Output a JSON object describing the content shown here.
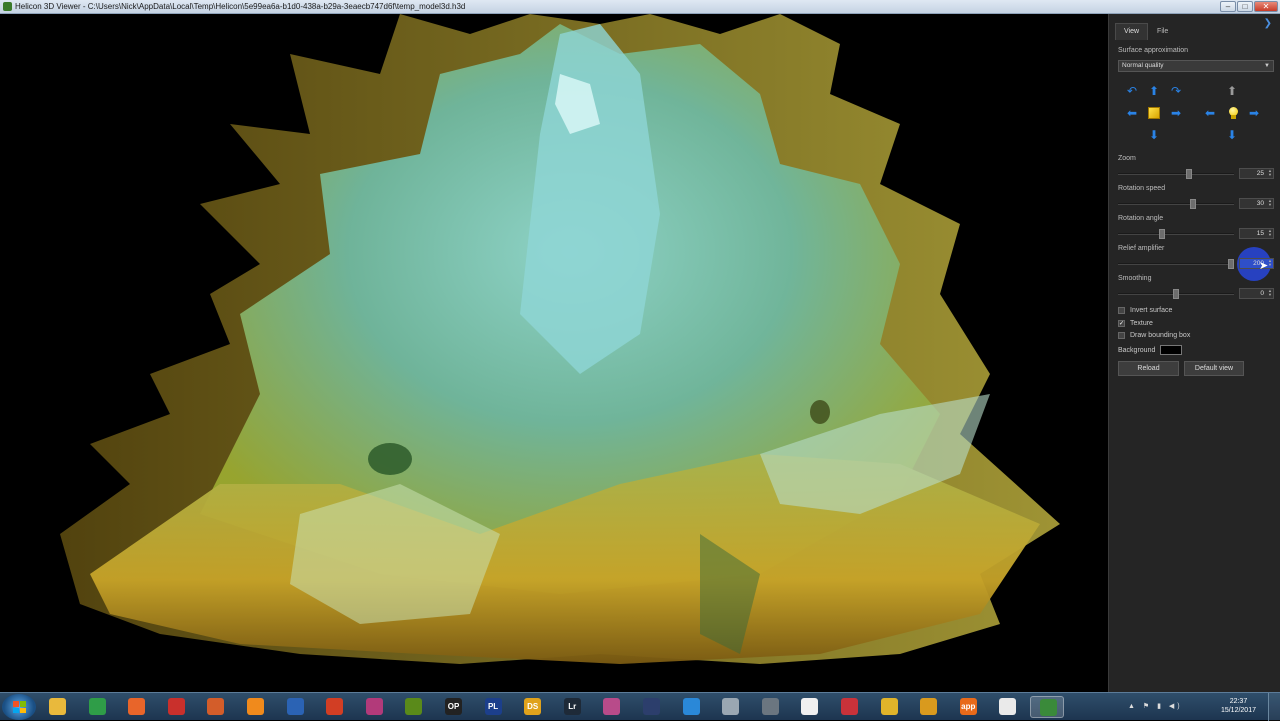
{
  "window": {
    "title": "Helicon 3D Viewer - C:\\Users\\Nick\\AppData\\Local\\Temp\\Helicon\\5e99ea6a-b1d0-438a-b29a-3eaecb747d6f\\temp_model3d.h3d",
    "min_label": "–",
    "max_label": "□",
    "close_label": "✕"
  },
  "panel": {
    "tabs": [
      {
        "label": "View",
        "active": true
      },
      {
        "label": "File",
        "active": false
      }
    ],
    "surface_approximation_label": "Surface approximation",
    "surface_approximation_value": "Normal quality",
    "zoom": {
      "label": "Zoom",
      "value": "25",
      "fraction": 0.62
    },
    "rotation_speed": {
      "label": "Rotation speed",
      "value": "30",
      "fraction": 0.65
    },
    "rotation_angle": {
      "label": "Rotation angle",
      "value": "15",
      "fraction": 0.37
    },
    "relief_amplifier": {
      "label": "Relief amplifier",
      "value": "200",
      "fraction": 1.0
    },
    "smoothing": {
      "label": "Smoothing",
      "value": "0",
      "fraction": 0.5
    },
    "invert_surface": {
      "label": "Invert surface",
      "checked": false
    },
    "texture": {
      "label": "Texture",
      "checked": true
    },
    "draw_bounding_box": {
      "label": "Draw bounding box",
      "checked": false
    },
    "background": {
      "label": "Background",
      "color": "#000000"
    },
    "reload_label": "Reload",
    "default_view_label": "Default view"
  },
  "taskbar": {
    "items": [
      {
        "icon": "explorer-icon",
        "text": "",
        "color": "#e9b93c"
      },
      {
        "icon": "chrome-icon",
        "text": "",
        "color": "#2f9d48"
      },
      {
        "icon": "firefox-icon",
        "text": "",
        "color": "#e8652a"
      },
      {
        "icon": "app-icon",
        "text": "",
        "color": "#c9302c"
      },
      {
        "icon": "eye-icon",
        "text": "",
        "color": "#d35d2a"
      },
      {
        "icon": "app-icon",
        "text": "",
        "color": "#f08a1c"
      },
      {
        "icon": "thunderbird-icon",
        "text": "",
        "color": "#2b63b4"
      },
      {
        "icon": "app-icon",
        "text": "",
        "color": "#d23e24"
      },
      {
        "icon": "app-icon",
        "text": "",
        "color": "#b23a7a"
      },
      {
        "icon": "app-icon",
        "text": "",
        "color": "#5a8a1a"
      },
      {
        "icon": "app-icon",
        "text": "OP",
        "color": "#222222"
      },
      {
        "icon": "app-icon",
        "text": "PL",
        "color": "#1c3f8c"
      },
      {
        "icon": "app-icon",
        "text": "DS",
        "color": "#e0a21c"
      },
      {
        "icon": "lightroom-icon",
        "text": "Lr",
        "color": "#1e2a38"
      },
      {
        "icon": "app-icon",
        "text": "",
        "color": "#b84b8a"
      },
      {
        "icon": "app-icon",
        "text": "",
        "color": "#2c3e6c"
      },
      {
        "icon": "app-icon",
        "text": "",
        "color": "#2a88d8"
      },
      {
        "icon": "app-icon",
        "text": "",
        "color": "#9aa7b2"
      },
      {
        "icon": "camera-icon",
        "text": "",
        "color": "#6b7680"
      },
      {
        "icon": "app-icon",
        "text": "",
        "color": "#f0f0f0"
      },
      {
        "icon": "app-icon",
        "text": "",
        "color": "#c8323a"
      },
      {
        "icon": "app-icon",
        "text": "",
        "color": "#e0b42a"
      },
      {
        "icon": "app-icon",
        "text": "",
        "color": "#d99a1e"
      },
      {
        "icon": "app-icon",
        "text": "app",
        "color": "#e86a1a"
      },
      {
        "icon": "document-icon",
        "text": "",
        "color": "#eaeaea"
      },
      {
        "icon": "helicon-icon",
        "text": "",
        "color": "#3a8a3a"
      }
    ],
    "clock_time": "22:37",
    "clock_date": "15/12/2017"
  }
}
